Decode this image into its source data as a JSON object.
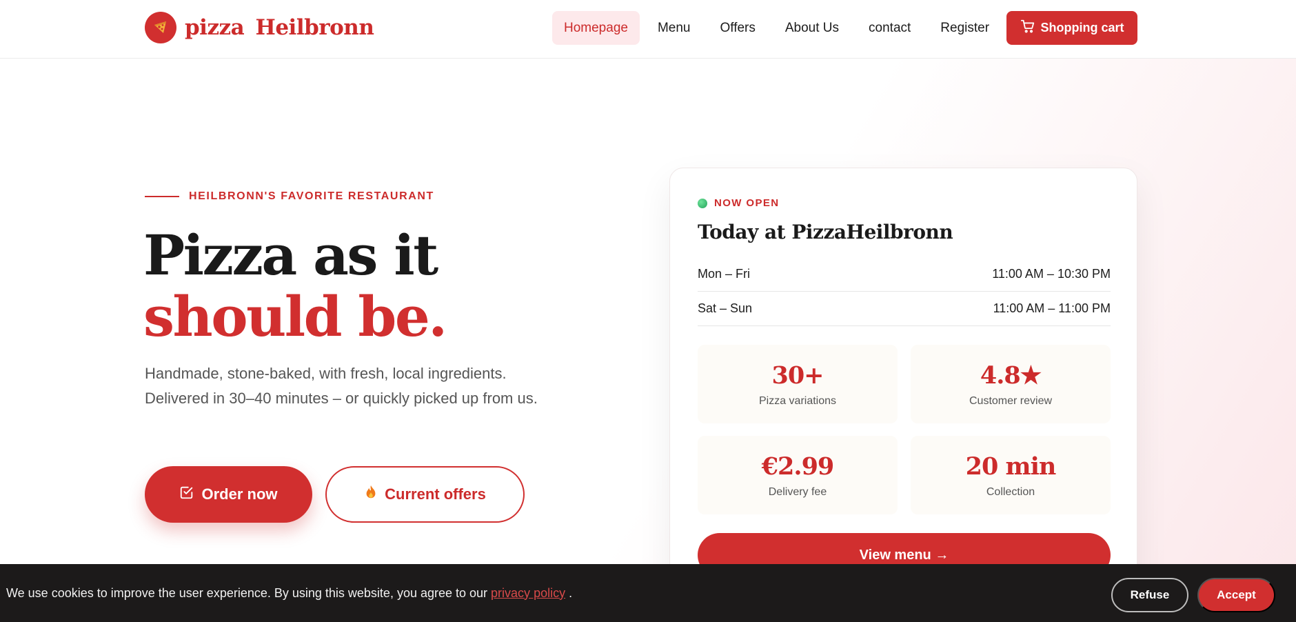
{
  "brand": {
    "name": "pizza  Heilbronn",
    "logo_icon": "pizza-slice-icon",
    "accent_color": "#d12f2f"
  },
  "nav": {
    "items": [
      {
        "label": "Homepage",
        "active": true
      },
      {
        "label": "Menu",
        "active": false
      },
      {
        "label": "Offers",
        "active": false
      },
      {
        "label": "About Us",
        "active": false
      },
      {
        "label": "contact",
        "active": false
      },
      {
        "label": "Register",
        "active": false
      }
    ],
    "cart_label": "Shopping cart",
    "cart_icon": "cart-icon"
  },
  "hero": {
    "eyebrow": "HEILBRONN'S FAVORITE RESTAURANT",
    "headline_part1": "Pizza as it ",
    "headline_accent": "should be.",
    "subtext": "Handmade, stone-baked, with fresh, local ingredients. Delivered in 30–40 minutes – or quickly picked up from us.",
    "order_label": "Order now",
    "order_icon": "checkbox-icon",
    "offers_label": "Current offers",
    "offers_icon": "flame-icon"
  },
  "card": {
    "status": "NOW OPEN",
    "status_color": "#22a35a",
    "title": "Today at PizzaHeilbronn",
    "hours": [
      {
        "days": "Mon – Fri",
        "time": "11:00 AM – 10:30 PM"
      },
      {
        "days": "Sat – Sun",
        "time": "11:00 AM – 11:00 PM"
      }
    ],
    "stats": [
      {
        "value": "30+",
        "label": "Pizza variations"
      },
      {
        "value": "4.8★",
        "label": "Customer review"
      },
      {
        "value": "€2.99",
        "label": "Delivery fee"
      },
      {
        "value": "20 min",
        "label": "Collection"
      }
    ],
    "menu_button": "View menu →"
  },
  "cookie": {
    "text": "We use cookies to improve the user experience. By using this website, you agree to our",
    "link": "privacy policy",
    "suffix": ".",
    "refuse": "Refuse",
    "accept": "Accept"
  }
}
